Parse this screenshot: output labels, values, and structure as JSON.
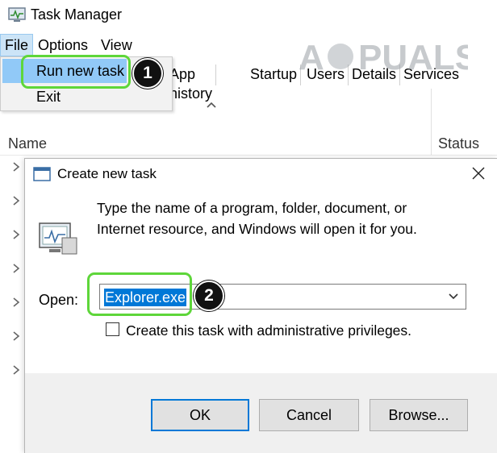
{
  "task_manager": {
    "title": "Task Manager",
    "menu": {
      "file": "File",
      "options": "Options",
      "view": "View"
    },
    "file_menu_items": {
      "run_new_task": "Run new task",
      "exit": "Exit"
    },
    "tabs": [
      "App history",
      "Startup",
      "Users",
      "Details",
      "Services"
    ],
    "columns": {
      "name": "Name",
      "status": "Status"
    }
  },
  "dialog": {
    "title": "Create new task",
    "description_line1": "Type the name of a program, folder, document, or",
    "description_line2": "Internet resource, and Windows will open it for you.",
    "open_label": "Open:",
    "open_value": "Explorer.exe",
    "admin_checkbox_label": "Create this task with administrative privileges.",
    "admin_checked": false,
    "buttons": {
      "ok": "OK",
      "cancel": "Cancel",
      "browse": "Browse..."
    }
  },
  "annotations": {
    "step1": "1",
    "step2": "2",
    "highlight_color": "#5ed63a"
  },
  "watermark": {
    "text": "APPUALS"
  },
  "colors": {
    "selection_blue": "#0078d7",
    "menu_highlight": "#91c9f7"
  }
}
